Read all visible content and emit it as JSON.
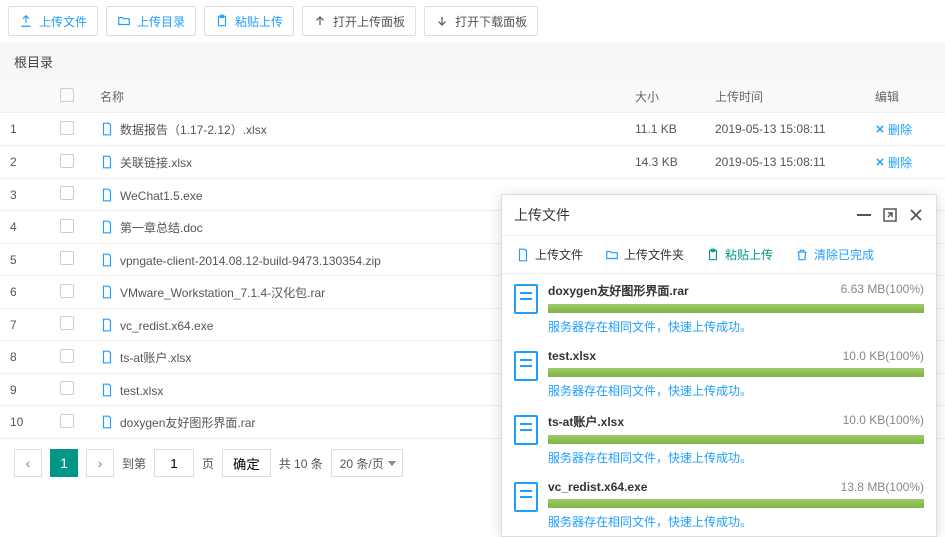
{
  "toolbar": {
    "upload_file": "上传文件",
    "upload_dir": "上传目录",
    "paste_upload": "粘贴上传",
    "open_upload_panel": "打开上传面板",
    "open_download_panel": "打开下载面板"
  },
  "root_dir": "根目录",
  "columns": {
    "name": "名称",
    "size": "大小",
    "time": "上传时间",
    "edit": "编辑"
  },
  "delete_label": "删除",
  "files": [
    {
      "idx": "1",
      "name": "数据报告（1.17-2.12）.xlsx",
      "size": "11.1 KB",
      "time": "2019-05-13 15:08:11",
      "showMeta": true
    },
    {
      "idx": "2",
      "name": "关联链接.xlsx",
      "size": "14.3 KB",
      "time": "2019-05-13 15:08:11",
      "showMeta": true
    },
    {
      "idx": "3",
      "name": "WeChat1.5.exe",
      "showMeta": false
    },
    {
      "idx": "4",
      "name": "第一章总结.doc",
      "showMeta": false
    },
    {
      "idx": "5",
      "name": "vpngate-client-2014.08.12-build-9473.130354.zip",
      "showMeta": false
    },
    {
      "idx": "6",
      "name": "VMware_Workstation_7.1.4-汉化包.rar",
      "showMeta": false
    },
    {
      "idx": "7",
      "name": "vc_redist.x64.exe",
      "showMeta": false
    },
    {
      "idx": "8",
      "name": "ts-at账户.xlsx",
      "showMeta": false
    },
    {
      "idx": "9",
      "name": "test.xlsx",
      "showMeta": false
    },
    {
      "idx": "10",
      "name": "doxygen友好图形界面.rar",
      "showMeta": false
    }
  ],
  "pager": {
    "current": "1",
    "goto_label_a": "到第",
    "goto_value": "1",
    "goto_label_b": "页",
    "confirm": "确定",
    "total": "共 10 条",
    "per_page": "20 条/页"
  },
  "panel": {
    "title": "上传文件",
    "tabs": {
      "upload_file": "上传文件",
      "upload_folder": "上传文件夹",
      "paste_upload": "粘贴上传",
      "clear_done": "清除已完成"
    },
    "success_msg": "服务器存在相同文件，快速上传成功。",
    "items": [
      {
        "name": "doxygen友好图形界面.rar",
        "size": "6.63 MB(100%)"
      },
      {
        "name": "test.xlsx",
        "size": "10.0 KB(100%)"
      },
      {
        "name": "ts-at账户.xlsx",
        "size": "10.0 KB(100%)"
      },
      {
        "name": "vc_redist.x64.exe",
        "size": "13.8 MB(100%)"
      }
    ]
  }
}
